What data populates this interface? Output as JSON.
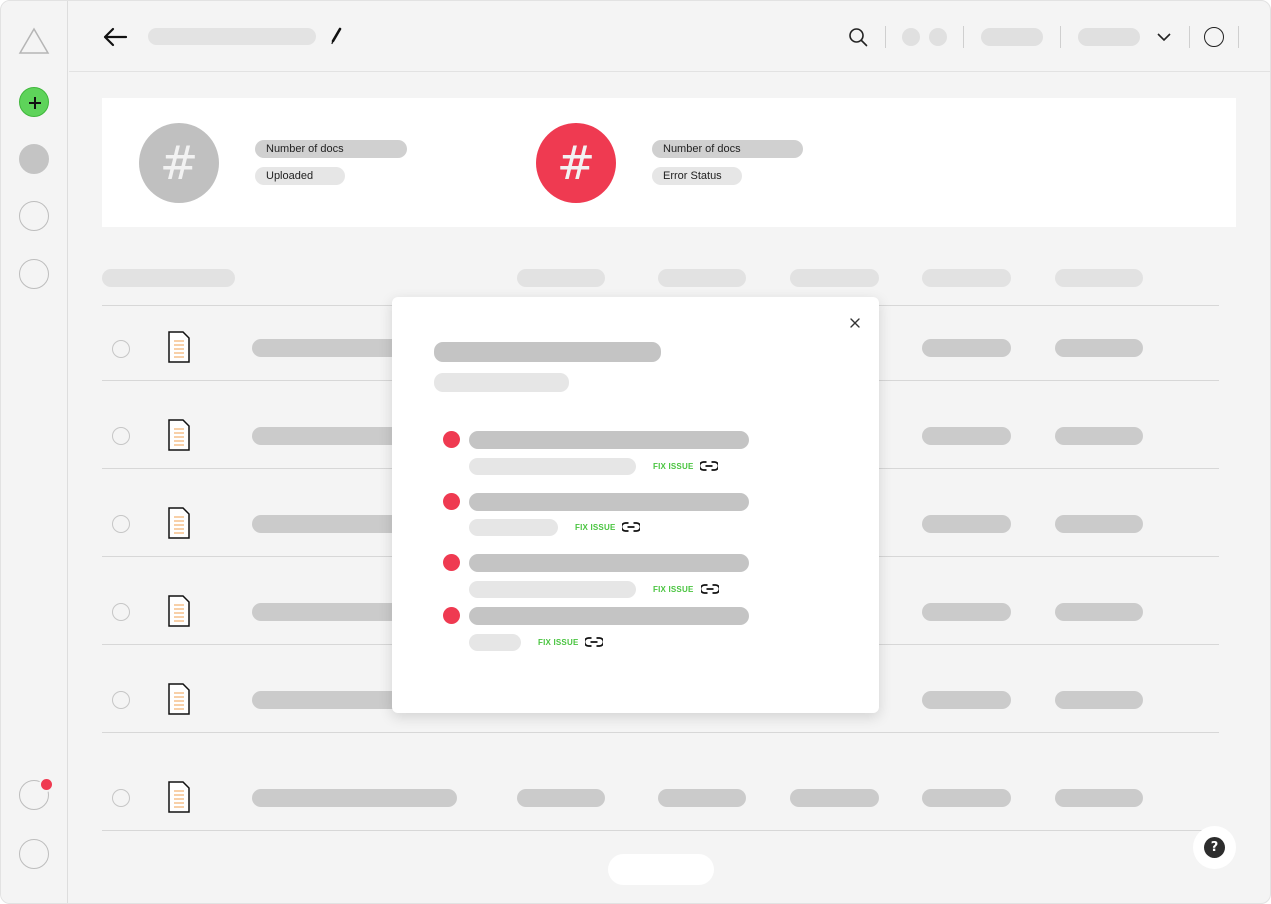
{
  "stats": {
    "uploaded": {
      "symbol": "#",
      "label": "Number of docs",
      "status": "Uploaded"
    },
    "error": {
      "symbol": "#",
      "label": "Number of docs",
      "status": "Error Status"
    }
  },
  "modal": {
    "issues": [
      {
        "action": "FIX ISSUE"
      },
      {
        "action": "FIX ISSUE"
      },
      {
        "action": "FIX ISSUE"
      },
      {
        "action": "FIX ISSUE"
      }
    ]
  },
  "help": {
    "symbol": "?"
  },
  "colors": {
    "accent_green": "#5ed35a",
    "error_red": "#ef3a51",
    "fix_green": "#49c43f",
    "neutral_grey": "#c0c0c0"
  },
  "icons": [
    "triangle-logo-icon",
    "plus-icon",
    "back-arrow-icon",
    "pencil-icon",
    "search-icon",
    "chevron-down-icon",
    "document-icon",
    "link-icon",
    "close-icon",
    "help-icon"
  ]
}
